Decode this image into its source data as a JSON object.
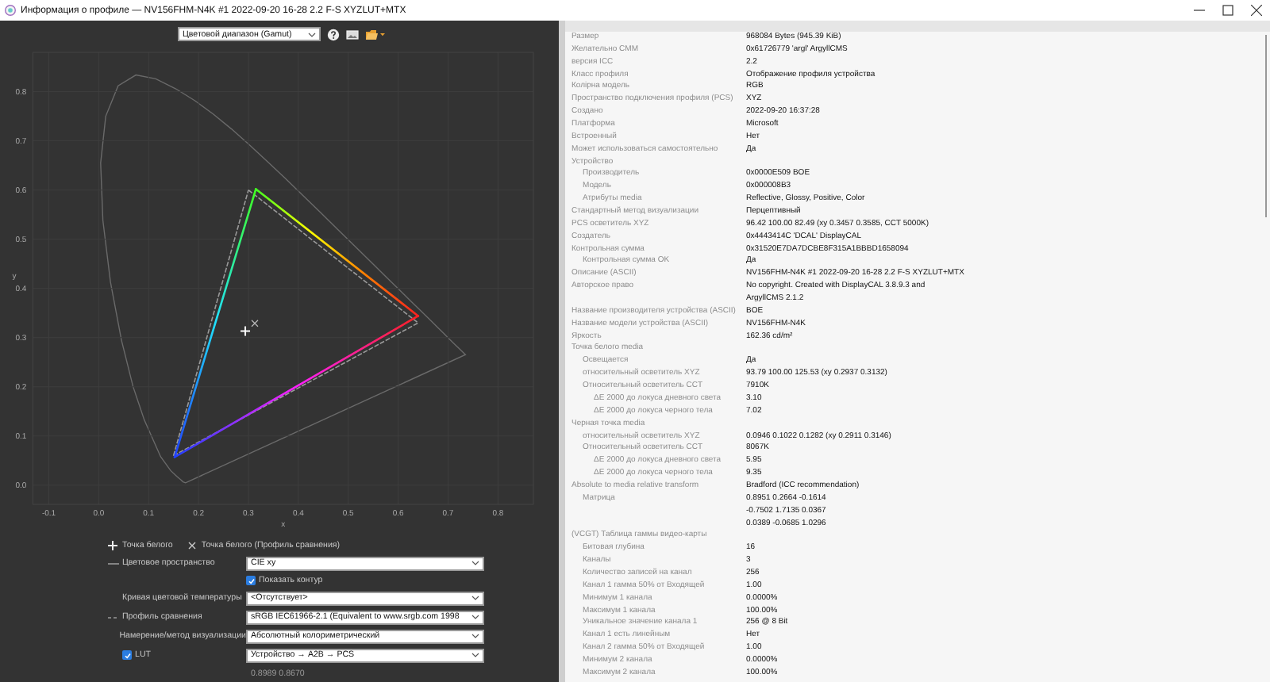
{
  "window": {
    "title": "Информация о профиле — NV156FHM-N4K #1 2022-09-20 16-28 2.2 F-S XYZLUT+MTX"
  },
  "toolbar": {
    "view_select": "Цветовой диапазон (Gamut)"
  },
  "gamut_plot": {
    "chart_data": {
      "type": "line",
      "xlabel": "x",
      "ylabel": "y",
      "xlim": [
        -0.132,
        0.871
      ],
      "ylim": [
        -0.039,
        0.88
      ],
      "xticks": [
        -0.1,
        {
          "value": 0,
          "label": "0.0"
        },
        0.1,
        0.2,
        0.3,
        0.4,
        0.5,
        0.6,
        0.7,
        0.8
      ],
      "yticks": [
        {
          "value": 0,
          "label": "0.0"
        },
        0.1,
        0.2,
        0.3,
        0.4,
        0.5,
        0.6,
        0.7,
        0.8
      ],
      "grid": true,
      "series": [
        {
          "color": "#9a9a9a",
          "line_style": "dashed",
          "x": [
            0.15,
            0.3
          ],
          "values": [
            0.06,
            0.6
          ]
        },
        {
          "color": "#9a9a9a",
          "line_style": "dashed",
          "x": [
            0.3,
            0.64
          ],
          "values": [
            0.6,
            0.33
          ]
        },
        {
          "color": "#9a9a9a",
          "line_style": "dashed",
          "x": [
            0.15,
            0.64
          ],
          "values": [
            0.06,
            0.33
          ]
        },
        {
          "x": [
            0.152,
            0.315
          ],
          "values": [
            0.057,
            0.602
          ]
        },
        {
          "x": [
            0.315,
            0.64
          ],
          "values": [
            0.602,
            0.344
          ]
        },
        {
          "x": [
            0.152,
            0.64
          ],
          "values": [
            0.057,
            0.344
          ]
        }
      ]
    }
  },
  "legend": [
    {
      "kind": "plus",
      "label": "Точка белого"
    },
    {
      "kind": "cross",
      "label": "Точка белого (Профиль сравнения)"
    }
  ],
  "controls": [
    {
      "kind": "select",
      "line_dashed": false,
      "label": "Цветовое пространство",
      "value": "CIE xy"
    },
    {
      "kind": "checkbox",
      "label": "Показать контур",
      "checked": true
    },
    {
      "kind": "select",
      "label": "Кривая цветовой температуры",
      "value": "<Отсутствует>"
    },
    {
      "kind": "select",
      "line_dashed": true,
      "label": "Профиль сравнения",
      "value": "sRGB IEC61966-2.1 (Equivalent to www.srgb.com 1998"
    },
    {
      "kind": "select",
      "label": "Намерение/метод визуализации",
      "value": "Абсолютный колориметрический"
    },
    {
      "kind": "select",
      "label": "LUT",
      "checked": true,
      "value": "Устройство → A2B → PCS"
    },
    {
      "kind": "readout",
      "value": "0.8989 0.8670"
    }
  ],
  "profile_info": [
    {
      "label": "Размер",
      "values": [
        "968084 Bytes (945.39 KiB)"
      ]
    },
    {
      "label": "Желательно CMM",
      "values": [
        "0x61726779 'argl' ArgyllCMS"
      ]
    },
    {
      "label": "версия ICC",
      "values": [
        "2.2"
      ]
    },
    {
      "label": "Класс профиля",
      "values": [
        "Отображение профиля устройства"
      ]
    },
    {
      "label": "Колірна модель",
      "values": [
        "RGB"
      ]
    },
    {
      "label": "Пространство подключения профиля (PCS)",
      "values": [
        "XYZ"
      ]
    },
    {
      "label": "Создано",
      "values": [
        "2022-09-20 16:37:28"
      ]
    },
    {
      "label": "Платформа",
      "values": [
        "Microsoft"
      ]
    },
    {
      "label": "Встроенный",
      "values": [
        "Нет"
      ]
    },
    {
      "label": "Может использоваться самостоятельно",
      "values": [
        "Да"
      ]
    },
    {
      "label": "Устройство",
      "children": [
        {
          "label": "Производитель",
          "values": [
            "0x0000E509 BOE"
          ]
        },
        {
          "label": "Модель",
          "values": [
            "0x000008B3"
          ]
        },
        {
          "label": "Атрибуты media",
          "values": [
            "Reflective, Glossy, Positive, Color"
          ]
        }
      ]
    },
    {
      "label": "Стандартный метод визуализации",
      "values": [
        "Перцептивный"
      ]
    },
    {
      "label": "PCS осветитель XYZ",
      "values": [
        "96.42 100.00 82.49 (xy 0.3457 0.3585, CCT 5000K)"
      ]
    },
    {
      "label": "Создатель",
      "values": [
        "0x4443414C 'DCAL' DisplayCAL"
      ]
    },
    {
      "label": "Контрольная сумма",
      "values": [
        "0x31520E7DA7DCBE8F315A1BBBD1658094"
      ],
      "children": [
        {
          "label": "Контрольная сумма OK",
          "values": [
            "Да"
          ]
        }
      ]
    },
    {
      "label": "Описание (ASCII)",
      "values": [
        "NV156FHM-N4K #1 2022-09-20 16-28 2.2 F-S XYZLUT+MTX"
      ]
    },
    {
      "label": "Авторское право",
      "values": [
        "No copyright. Created with DisplayCAL 3.8.9.3 and",
        "ArgyllCMS 2.1.2"
      ]
    },
    {
      "label": "Название производителя устройства (ASCII)",
      "values": [
        "BOE"
      ]
    },
    {
      "label": "Название модели устройства (ASCII)",
      "values": [
        "NV156FHM-N4K"
      ]
    },
    {
      "label": "Яркость",
      "values": [
        "162.36 cd/m²"
      ]
    },
    {
      "label": "Точка белого media",
      "children": [
        {
          "label": "Освещается",
          "values": [
            "Да"
          ]
        },
        {
          "label": "относительный осветитель XYZ",
          "values": [
            "93.79 100.00 125.53 (xy 0.2937 0.3132)"
          ]
        },
        {
          "label": "Относительный осветитель CCT",
          "values": [
            "7910K"
          ],
          "children": [
            {
              "label": "ΔE 2000 до локуса дневного света",
              "values": [
                "3.10"
              ]
            },
            {
              "label": "ΔE 2000 до локуса черного тела",
              "values": [
                "7.02"
              ]
            }
          ]
        }
      ]
    },
    {
      "label": "Черная точка media",
      "children": [
        {
          "label": "относительный осветитель XYZ",
          "values": [
            "0.0946 0.1022 0.1282 (xy 0.2911 0.3146)"
          ]
        },
        {
          "label": "Относительный осветитель CCT",
          "values": [
            "8067K"
          ],
          "children": [
            {
              "label": "ΔE 2000 до локуса дневного света",
              "values": [
                "5.95"
              ]
            },
            {
              "label": "ΔE 2000 до локуса черного тела",
              "values": [
                "9.35"
              ]
            }
          ]
        }
      ]
    },
    {
      "label": "Absolute to media relative transform",
      "values": [
        "Bradford (ICC recommendation)"
      ],
      "children": [
        {
          "label": "Матрица",
          "values": [
            "0.8951 0.2664 -0.1614",
            "-0.7502 1.7135 0.0367",
            "0.0389 -0.0685 1.0296"
          ]
        }
      ]
    },
    {
      "label": "(VCGT) Таблица гаммы видео-карты",
      "children": [
        {
          "label": "Битовая глубина",
          "values": [
            "16"
          ]
        },
        {
          "label": "Каналы",
          "values": [
            "3"
          ]
        },
        {
          "label": "Количество записей на канал",
          "values": [
            "256"
          ]
        },
        {
          "label": "Канал 1 гамма 50% от Входящей",
          "values": [
            "1.00"
          ]
        },
        {
          "label": "Минимум 1 канала",
          "values": [
            "0.0000%"
          ]
        },
        {
          "label": "Максимум 1 канала",
          "values": [
            "100.00%"
          ]
        },
        {
          "label": "Уникальное значение канала 1",
          "values": [
            "256 @ 8 Bit"
          ]
        },
        {
          "label": "Канал 1 есть линейным",
          "values": [
            "Нет"
          ]
        },
        {
          "label": "Канал 2 гамма 50% от Входящей",
          "values": [
            "1.00"
          ]
        },
        {
          "label": "Минимум 2 канала",
          "values": [
            "0.0000%"
          ]
        },
        {
          "label": "Максимум 2 канала",
          "values": [
            "100.00%"
          ]
        }
      ]
    }
  ]
}
